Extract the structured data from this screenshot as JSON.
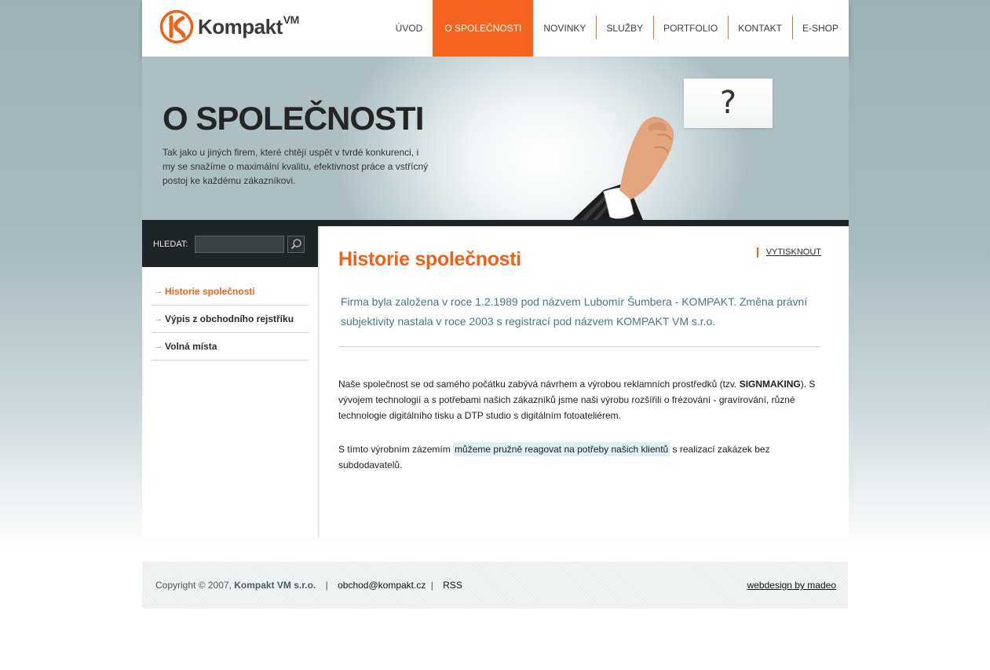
{
  "brand": {
    "name": "Kompakt",
    "suffix": "VM"
  },
  "nav": [
    {
      "label": "ÚVOD"
    },
    {
      "label": "O SPOLEČNOSTI"
    },
    {
      "label": "NOVINKY"
    },
    {
      "label": "SLUŽBY"
    },
    {
      "label": "PORTFOLIO"
    },
    {
      "label": "KONTAKT"
    },
    {
      "label": "E-SHOP"
    }
  ],
  "nav_active": "O SPOLEČNOSTI",
  "hero": {
    "title": "O SPOLEČNOSTI",
    "text": "Tak jako u jiných firem, které chtějí uspět v tvrdé konkurenci, i my se snažíme o maximální kvalitu, efektivnost práce a vstřícný postoj ke každému zákazníkovi.",
    "card_symbol": "?"
  },
  "search": {
    "label": "HLEDAT:",
    "value": ""
  },
  "sidebar": {
    "items": [
      {
        "label": "Historie společnosti"
      },
      {
        "label": "Výpis z obchodního rejstříku"
      },
      {
        "label": "Volná místa"
      }
    ]
  },
  "content": {
    "title": "Historie společnosti",
    "print_label": "VYTISKNOUT",
    "lead": "Firma byla založena v roce 1.2.1989 pod názvem Lubomír Šumbera - KOMPAKT. Změna právní subjektivity nastala v roce 2003 s registrací pod názvem KOMPAKT VM s.r.o.",
    "p1_before": "Naše společnost se od samého počátku zabývá návrhem a výrobou reklamních prostředků (tzv. ",
    "p1_bold": "SIGNMAKING",
    "p1_after": "). S vývojem technologií a s potřebami našich zákazníků jsme naši výrobu rozšířili o frézování - gravírování, různé technologie digitálního tisku a DTP studio s digitálním fotoateliérem.",
    "p2_before": "S tímto výrobním zázemím ",
    "p2_highlight": "můžeme pružně reagovat na potřeby našich klientů",
    "p2_after": " s realizací zakázek bez subdodavatelů."
  },
  "footer": {
    "copyright": "Copyright © 2007,",
    "company": "Kompakt VM s.r.o.",
    "sep": "|",
    "email": "obchod@kompakt.cz",
    "rss": "RSS",
    "credit": "webdesign by madeo"
  },
  "colors": {
    "accent": "#f5641f",
    "dark": "#1f2426",
    "lead_text": "#4b7586"
  }
}
